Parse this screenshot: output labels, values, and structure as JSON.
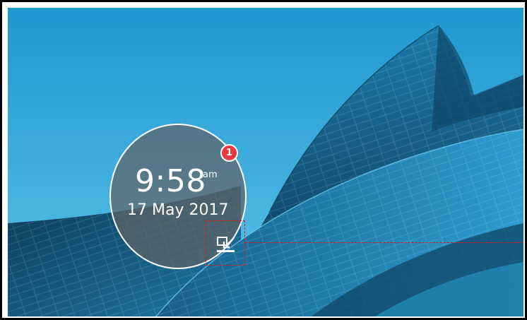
{
  "clock": {
    "time": "9:58",
    "meridiem": "am",
    "date": "17 May 2017"
  },
  "notifications": {
    "count": "1"
  },
  "icons": {
    "pin": "pin-window-icon"
  },
  "colors": {
    "sky": "#2aa3d6",
    "building_dark": "#0f3f5a",
    "building_mid": "#1a6a92",
    "badge": "#e8393e",
    "annotation": "#e01818"
  }
}
